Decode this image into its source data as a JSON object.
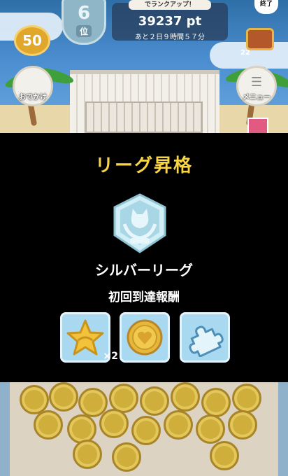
{
  "header": {
    "rank_number": "6",
    "rank_unit": "位",
    "rank_up_banner": "でランクアップ！",
    "score": "39237 pt",
    "time_remaining": "あと２日９時間５７分",
    "coins": "50",
    "end_button": "終了",
    "chest_count": "22",
    "outing_button": "おでかけ",
    "menu_button": "メニュー"
  },
  "dialog": {
    "title": "リーグ昇格",
    "emblem_icon": "silver-league-emblem-icon",
    "league_name": "シルバーリーグ",
    "reward_label": "初回到達報酬",
    "rewards": [
      {
        "icon": "star-icon",
        "quantity": "×2"
      },
      {
        "icon": "heart-medal-icon",
        "quantity": ""
      },
      {
        "icon": "puzzle-piece-icon",
        "quantity": ""
      }
    ]
  },
  "colors": {
    "title_yellow": "#f7d545",
    "tile_blue": "#a9d8f1",
    "emblem_silver": "#bfe4ef",
    "overlay": "#000000"
  }
}
